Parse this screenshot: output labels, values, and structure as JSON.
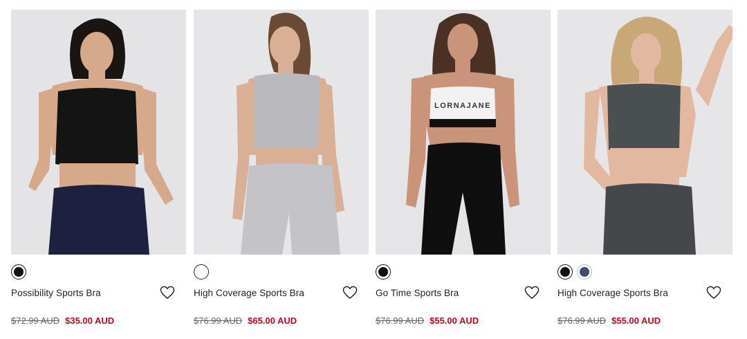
{
  "products": [
    {
      "name": "Possibility Sports Bra",
      "original_price": "$72.99 AUD",
      "sale_price": "$35.00 AUD",
      "swatches": [
        {
          "color": "#111111"
        }
      ],
      "photo": {
        "top": "#141414",
        "bottom": "#1e2040",
        "skin": "#d6a98a",
        "hair": "#1a1412"
      }
    },
    {
      "name": "High Coverage Sports Bra",
      "original_price": "$76.99 AUD",
      "sale_price": "$65.00 AUD",
      "swatches": [
        {
          "color": "#ffffff"
        }
      ],
      "photo": {
        "top": "#b9b9bd",
        "bottom": "#c4c4c8",
        "skin": "#d9b096",
        "hair": "#6a4a35"
      }
    },
    {
      "name": "Go Time Sports Bra",
      "original_price": "$76.99 AUD",
      "sale_price": "$55.00 AUD",
      "swatches": [
        {
          "color": "#111111"
        }
      ],
      "photo": {
        "top": "#f2f2f2",
        "bottom": "#0f0f10",
        "skin": "#c99479",
        "hair": "#4a3124",
        "top_text": "LORNAJANE"
      }
    },
    {
      "name": "High Coverage Sports Bra",
      "original_price": "$76.99 AUD",
      "sale_price": "$55.00 AUD",
      "swatches": [
        {
          "color": "#111111"
        },
        {
          "color": "#3f4f72"
        }
      ],
      "photo": {
        "top": "#4a4f52",
        "bottom": "#45484b",
        "skin": "#e2b9a0",
        "hair": "#c9a878"
      }
    }
  ],
  "colors": {
    "sale_red": "#d0021b",
    "strike_grey": "#666666",
    "image_bg": "#e3e3e5"
  }
}
